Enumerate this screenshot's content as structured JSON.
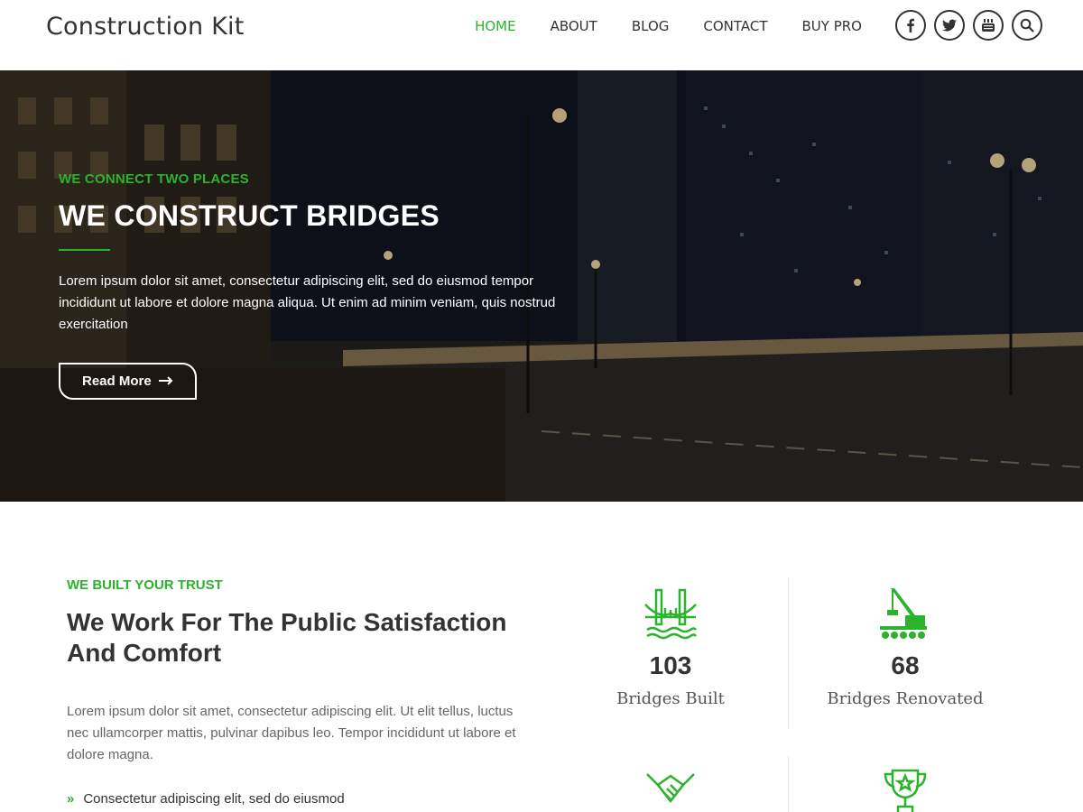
{
  "header": {
    "logo": "Construction Kit",
    "nav": [
      "HOME",
      "ABOUT",
      "BLOG",
      "CONTACT",
      "BUY PRO"
    ],
    "active_index": 0,
    "socials": [
      "facebook-icon",
      "twitter-icon",
      "youtube-icon",
      "search-icon"
    ]
  },
  "hero": {
    "kicker": "WE CONNECT TWO PLACES",
    "title": "WE CONSTRUCT BRIDGES",
    "text": "Lorem ipsum dolor sit amet, consectetur adipiscing elit, sed do eiusmod tempor incididunt ut labore et dolore magna aliqua. Ut enim ad minim veniam, quis nostrud exercitation",
    "button": "Read More"
  },
  "trust": {
    "kicker": "WE BUILT YOUR TRUST",
    "title": "We Work For The Public Satisfaction And Comfort",
    "text": "Lorem ipsum dolor sit amet, consectetur adipiscing elit. Ut elit tellus, luctus nec ullamcorper mattis, pulvinar dapibus leo. Tempor incididunt ut labore et dolore magna.",
    "points": [
      "Consectetur adipiscing elit, sed do eiusmod"
    ]
  },
  "stats": [
    {
      "icon": "bridge-icon",
      "number": "103",
      "label": "Bridges Built"
    },
    {
      "icon": "crane-icon",
      "number": "68",
      "label": "Bridges Renovated"
    },
    {
      "icon": "handshake-icon",
      "number": "",
      "label": ""
    },
    {
      "icon": "trophy-icon",
      "number": "",
      "label": ""
    }
  ],
  "colors": {
    "accent": "#2bb32b",
    "text": "#333333"
  }
}
